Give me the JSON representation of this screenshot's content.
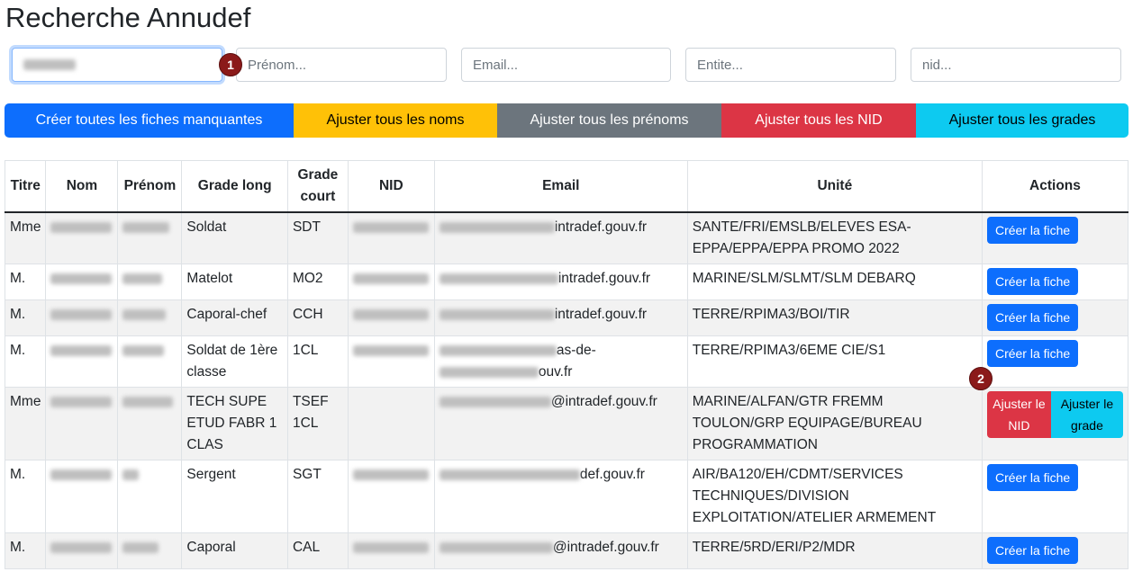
{
  "page": {
    "title": "Recherche Annudef"
  },
  "search": {
    "nom_value": "",
    "prenom_placeholder": "Prénom...",
    "email_placeholder": "Email...",
    "entite_placeholder": "Entite...",
    "nid_placeholder": "nid..."
  },
  "markers": {
    "m1": "1",
    "m2": "2"
  },
  "bulk_actions": {
    "create_all": "Créer toutes les fiches manquantes",
    "adjust_names": "Ajuster tous les noms",
    "adjust_firstnames": "Ajuster tous les prénoms",
    "adjust_nids": "Ajuster tous les NID",
    "adjust_grades": "Ajuster tous les grades"
  },
  "colors": {
    "primary": "#0d6efd",
    "warning": "#ffc107",
    "secondary": "#6c757d",
    "danger": "#dc3545",
    "info": "#0dcaf0",
    "marker": "#8b1a1a"
  },
  "table": {
    "headers": {
      "titre": "Titre",
      "nom": "Nom",
      "prenom": "Prénom",
      "grade_long": "Grade long",
      "grade_court": "Grade court",
      "nid": "NID",
      "email": "Email",
      "unite": "Unité",
      "actions": "Actions"
    },
    "rows": [
      {
        "titre": "Mme",
        "grade_long": "Soldat",
        "grade_court": "SDT",
        "email_suffix": "intradef.gouv.fr",
        "unite": "SANTE/FRI/EMSLB/ELEVES ESA-EPPA/EPPA/EPPA PROMO 2022",
        "action": "Créer la fiche"
      },
      {
        "titre": "M.",
        "grade_long": "Matelot",
        "grade_court": "MO2",
        "email_suffix": "intradef.gouv.fr",
        "unite": "MARINE/SLM/SLMT/SLM DEBARQ",
        "action": "Créer la fiche"
      },
      {
        "titre": "M.",
        "grade_long": "Caporal-chef",
        "grade_court": "CCH",
        "email_suffix": "intradef.gouv.fr",
        "unite": "TERRE/RPIMA3/BOI/TIR",
        "action": "Créer la fiche"
      },
      {
        "titre": "M.",
        "grade_long": "Soldat de 1ère classe",
        "grade_court": "1CL",
        "email_suffix": "as-de-",
        "email_suffix2": "ouv.fr",
        "unite": "TERRE/RPIMA3/6EME CIE/S1",
        "action": "Créer la fiche"
      },
      {
        "titre": "Mme",
        "grade_long": "TECH SUPE ETUD FABR 1 CLAS",
        "grade_court": "TSEF 1CL",
        "email_suffix": "@intradef.gouv.fr",
        "unite": "MARINE/ALFAN/GTR FREMM TOULON/GRP EQUIPAGE/BUREAU PROGRAMMATION",
        "action_nid": "Ajuster le NID",
        "action_grade": "Ajuster le grade"
      },
      {
        "titre": "M.",
        "grade_long": "Sergent",
        "grade_court": "SGT",
        "email_suffix": "def.gouv.fr",
        "unite": "AIR/BA120/EH/CDMT/SERVICES TECHNIQUES/DIVISION EXPLOITATION/ATELIER ARMEMENT",
        "action": "Créer la fiche"
      },
      {
        "titre": "M.",
        "grade_long": "Caporal",
        "grade_court": "CAL",
        "email_suffix": "@intradef.gouv.fr",
        "unite": "TERRE/5RD/ERI/P2/MDR",
        "action": "Créer la fiche"
      }
    ]
  }
}
